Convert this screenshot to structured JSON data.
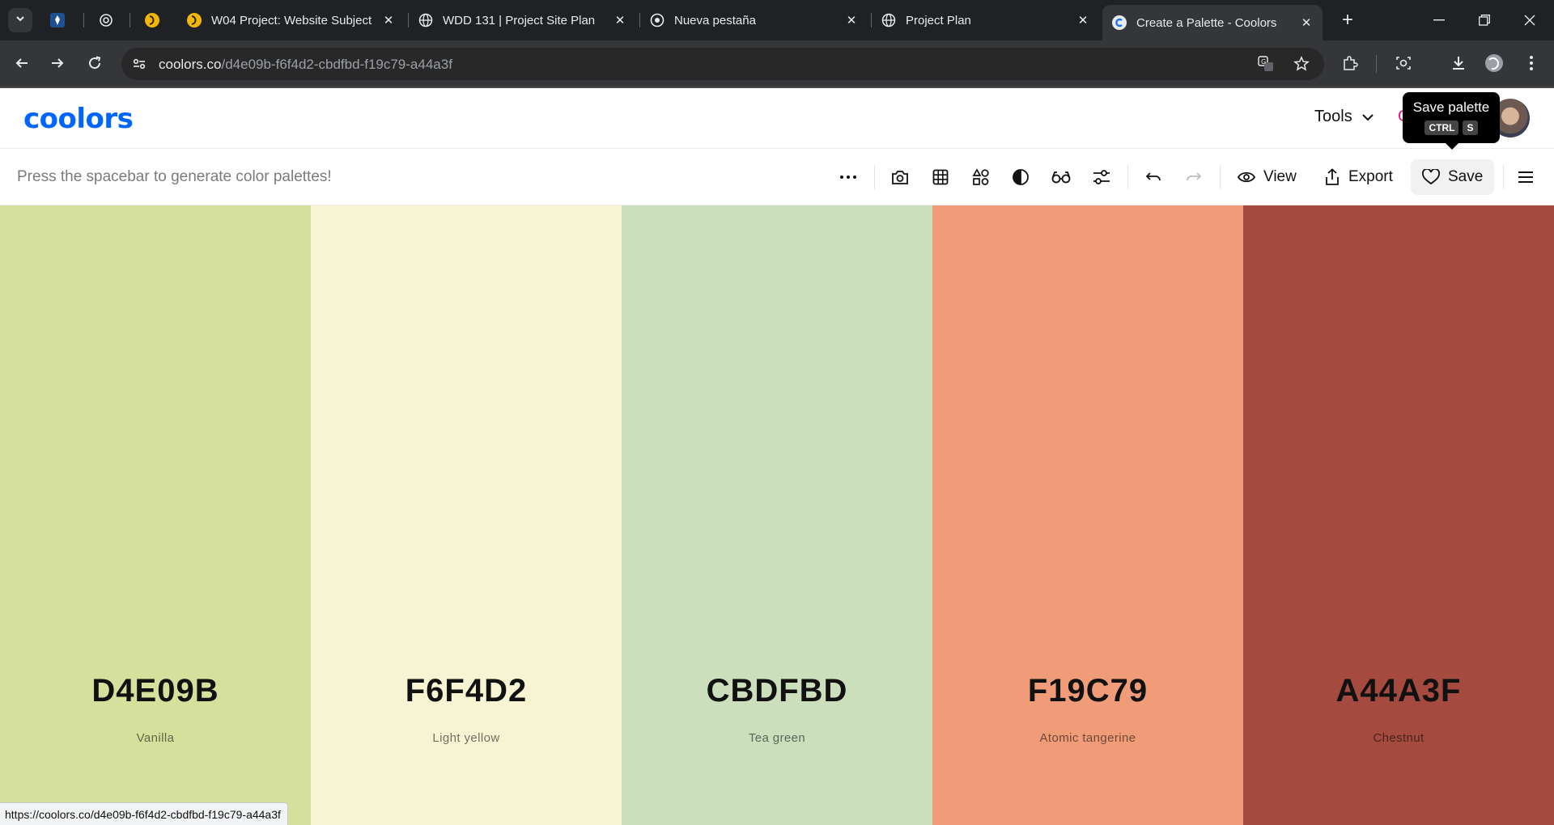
{
  "browser": {
    "tabs": [
      {
        "title": "",
        "icon": "pinned-site-icon"
      },
      {
        "title": "",
        "icon": "openai-icon"
      },
      {
        "title": "",
        "icon": "byu-icon"
      },
      {
        "title": "W04 Project: Website Subject",
        "icon": "byu-icon"
      },
      {
        "title": "WDD 131 | Project Site Plan",
        "icon": "globe-icon"
      },
      {
        "title": "Nueva pestaña",
        "icon": "chrome-icon"
      },
      {
        "title": "Project Plan",
        "icon": "globe-icon"
      },
      {
        "title": "Create a Palette - Coolors",
        "icon": "coolors-icon",
        "active": true
      }
    ],
    "url_host": "coolors.co",
    "url_path": "/d4e09b-f6f4d2-cbdfbd-f19c79-a44a3f",
    "status_url": "https://coolors.co/d4e09b-f6f4d2-cbdfbd-f19c79-a44a3f"
  },
  "header": {
    "logo": "coolors",
    "tools_label": "Tools",
    "peek_text": "G"
  },
  "tooltip": {
    "title": "Save palette",
    "key1": "CTRL",
    "key2": "S"
  },
  "generator": {
    "hint": "Press the spacebar to generate color palettes!",
    "view_label": "View",
    "export_label": "Export",
    "save_label": "Save"
  },
  "palette": [
    {
      "hex": "D4E09B",
      "name": "Vanilla",
      "color": "#D4E09B"
    },
    {
      "hex": "F6F4D2",
      "name": "Light yellow",
      "color": "#F6F4D2"
    },
    {
      "hex": "CBDFBD",
      "name": "Tea green",
      "color": "#CBDFBD"
    },
    {
      "hex": "F19C79",
      "name": "Atomic tangerine",
      "color": "#F19C79"
    },
    {
      "hex": "A44A3F",
      "name": "Chestnut",
      "color": "#A44A3F"
    }
  ]
}
